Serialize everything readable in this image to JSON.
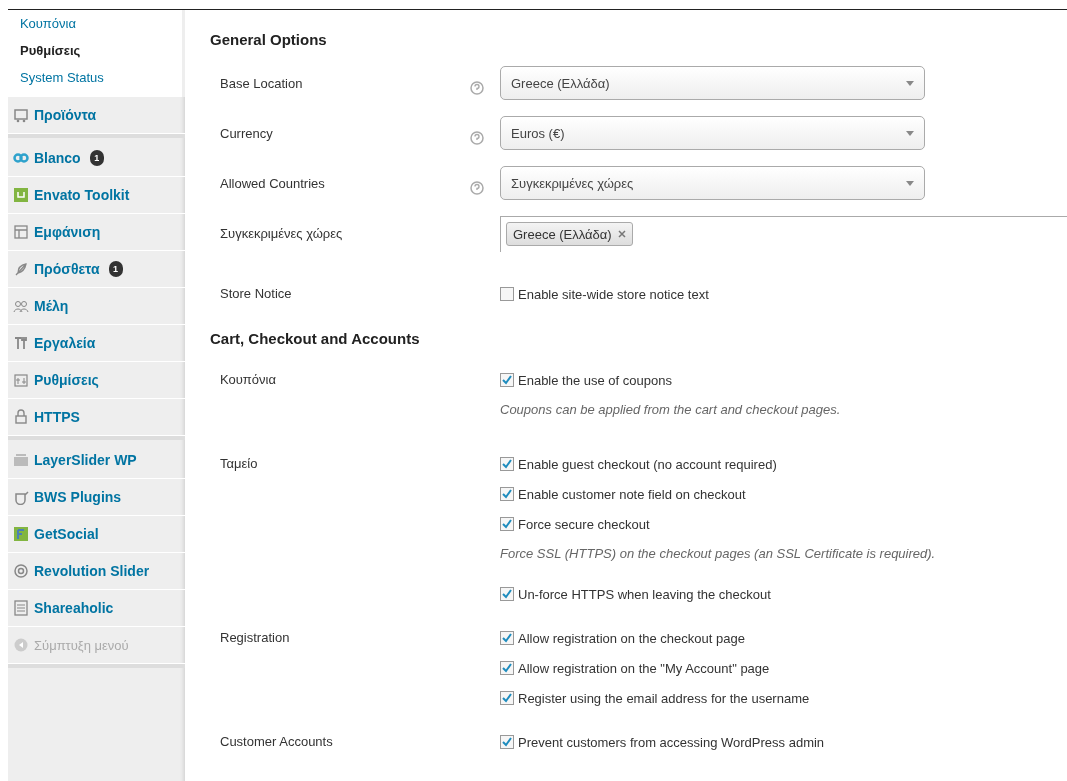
{
  "submenu": [
    {
      "label": "Κουπόνια",
      "selected": false
    },
    {
      "label": "Ρυθμίσεις",
      "selected": true
    },
    {
      "label": "System Status",
      "selected": false
    }
  ],
  "menu_groups": [
    [
      {
        "label": "Προϊόντα",
        "kind": "item"
      }
    ],
    [
      {
        "label": "Blanco",
        "kind": "item",
        "badge": "1"
      },
      {
        "label": "Envato Toolkit",
        "kind": "item"
      },
      {
        "label": "Εμφάνιση",
        "kind": "item"
      },
      {
        "label": "Πρόσθετα",
        "kind": "item",
        "badge": "1"
      },
      {
        "label": "Μέλη",
        "kind": "item"
      },
      {
        "label": "Εργαλεία",
        "kind": "item"
      },
      {
        "label": "Ρυθμίσεις",
        "kind": "item"
      },
      {
        "label": "HTTPS",
        "kind": "item"
      }
    ],
    [
      {
        "label": "LayerSlider WP",
        "kind": "item"
      },
      {
        "label": "BWS Plugins",
        "kind": "item"
      },
      {
        "label": "GetSocial",
        "kind": "item"
      },
      {
        "label": "Revolution Slider",
        "kind": "item"
      },
      {
        "label": "Shareaholic",
        "kind": "item"
      },
      {
        "label": "Σύμπτυξη μενού",
        "kind": "collapse"
      }
    ]
  ],
  "sections": [
    {
      "title": "General Options",
      "rows": [
        {
          "label": "Base Location",
          "kind": "select",
          "help": true,
          "value": "Greece (Ελλάδα)"
        },
        {
          "label": "Currency",
          "kind": "select",
          "help": true,
          "value": "Euros (€)"
        },
        {
          "label": "Allowed Countries",
          "kind": "select",
          "help": true,
          "value": "Συγκεκριμένες χώρες"
        },
        {
          "label": "Συγκεκριμένες χώρες",
          "kind": "multiselect",
          "help": false,
          "tags": [
            "Greece (Ελλάδα)"
          ]
        },
        {
          "label": "Store Notice",
          "kind": "checks",
          "help": false,
          "options": [
            {
              "kind": "checkbox",
              "label": "Enable site-wide store notice text",
              "checked": false
            }
          ]
        }
      ]
    },
    {
      "title": "Cart, Checkout and Accounts",
      "rows": [
        {
          "label": "Κουπόνια",
          "kind": "checks",
          "help": false,
          "options": [
            {
              "kind": "checkbox",
              "label": "Enable the use of coupons",
              "checked": true
            },
            {
              "kind": "note",
              "text": "Coupons can be applied from the cart and checkout pages."
            }
          ]
        },
        {
          "label": "Ταμείο",
          "kind": "checks",
          "help": false,
          "options": [
            {
              "kind": "checkbox",
              "label": "Enable guest checkout (no account required)",
              "checked": true
            },
            {
              "kind": "checkbox",
              "label": "Enable customer note field on checkout",
              "checked": true
            },
            {
              "kind": "checkbox",
              "label": "Force secure checkout",
              "checked": true
            },
            {
              "kind": "note",
              "text": "Force SSL (HTTPS) on the checkout pages (an SSL Certificate is required)."
            },
            {
              "kind": "checkbox",
              "label": "Un-force HTTPS when leaving the checkout",
              "checked": true
            }
          ]
        },
        {
          "label": "Registration",
          "kind": "checks",
          "help": false,
          "options": [
            {
              "kind": "checkbox",
              "label": "Allow registration on the checkout page",
              "checked": true
            },
            {
              "kind": "checkbox",
              "label": "Allow registration on the \"My Account\" page",
              "checked": true
            },
            {
              "kind": "checkbox",
              "label": "Register using the email address for the username",
              "checked": true
            }
          ]
        },
        {
          "label": "Customer Accounts",
          "kind": "checks",
          "help": false,
          "options": [
            {
              "kind": "checkbox",
              "label": "Prevent customers from accessing WordPress admin",
              "checked": true
            }
          ]
        }
      ]
    }
  ]
}
